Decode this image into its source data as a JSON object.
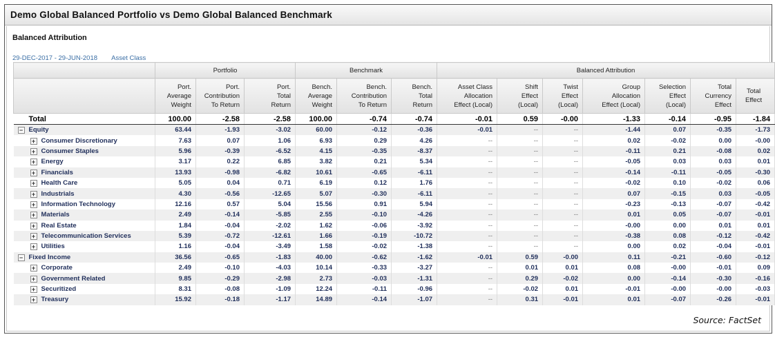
{
  "window_title": "Demo Global Balanced Portfolio vs Demo Global Balanced Benchmark",
  "report_title": "Balanced Attribution",
  "date_range": "29-DEC-2017 - 29-JUN-2018",
  "grouping": "Asset Class",
  "group_headers": [
    "Portfolio",
    "Benchmark",
    "Balanced Attribution"
  ],
  "columns": [
    [
      "Port.",
      "Average",
      "Weight"
    ],
    [
      "Port.",
      "Contribution",
      "To Return"
    ],
    [
      "Port.",
      "Total",
      "Return"
    ],
    [
      "Bench.",
      "Average",
      "Weight"
    ],
    [
      "Bench.",
      "Contribution",
      "To Return"
    ],
    [
      "Bench.",
      "Total",
      "Return"
    ],
    [
      "Asset Class",
      "Allocation",
      "Effect (Local)"
    ],
    [
      "Shift",
      "Effect",
      "(Local)"
    ],
    [
      "Twist",
      "Effect",
      "(Local)"
    ],
    [
      "Group",
      "Allocation",
      "Effect (Local)"
    ],
    [
      "Selection",
      "Effect",
      "(Local)"
    ],
    [
      "Total",
      "Currency",
      "Effect"
    ],
    [
      "Total",
      "Effect",
      ""
    ]
  ],
  "total_row": {
    "label": "Total",
    "values": [
      "100.00",
      "-2.58",
      "-2.58",
      "100.00",
      "-0.74",
      "-0.74",
      "-0.01",
      "0.59",
      "-0.00",
      "-1.33",
      "-0.14",
      "-0.95",
      "-1.84"
    ]
  },
  "rows": [
    {
      "label": "Equity",
      "level": 0,
      "expander": "minus",
      "values": [
        "63.44",
        "-1.93",
        "-3.02",
        "60.00",
        "-0.12",
        "-0.36",
        "-0.01",
        "--",
        "--",
        "-1.44",
        "0.07",
        "-0.35",
        "-1.73"
      ]
    },
    {
      "label": "Consumer Discretionary",
      "level": 1,
      "expander": "plus",
      "values": [
        "7.63",
        "0.07",
        "1.06",
        "6.93",
        "0.29",
        "4.26",
        "--",
        "--",
        "--",
        "0.02",
        "-0.02",
        "0.00",
        "-0.00"
      ]
    },
    {
      "label": "Consumer Staples",
      "level": 1,
      "expander": "plus",
      "values": [
        "5.96",
        "-0.39",
        "-6.52",
        "4.15",
        "-0.35",
        "-8.37",
        "--",
        "--",
        "--",
        "-0.11",
        "0.21",
        "-0.08",
        "0.02"
      ]
    },
    {
      "label": "Energy",
      "level": 1,
      "expander": "plus",
      "values": [
        "3.17",
        "0.22",
        "6.85",
        "3.82",
        "0.21",
        "5.34",
        "--",
        "--",
        "--",
        "-0.05",
        "0.03",
        "0.03",
        "0.01"
      ]
    },
    {
      "label": "Financials",
      "level": 1,
      "expander": "plus",
      "values": [
        "13.93",
        "-0.98",
        "-6.82",
        "10.61",
        "-0.65",
        "-6.11",
        "--",
        "--",
        "--",
        "-0.14",
        "-0.11",
        "-0.05",
        "-0.30"
      ]
    },
    {
      "label": "Health Care",
      "level": 1,
      "expander": "plus",
      "values": [
        "5.05",
        "0.04",
        "0.71",
        "6.19",
        "0.12",
        "1.76",
        "--",
        "--",
        "--",
        "-0.02",
        "0.10",
        "-0.02",
        "0.06"
      ]
    },
    {
      "label": "Industrials",
      "level": 1,
      "expander": "plus",
      "values": [
        "4.30",
        "-0.56",
        "-12.65",
        "5.07",
        "-0.30",
        "-6.11",
        "--",
        "--",
        "--",
        "0.07",
        "-0.15",
        "0.03",
        "-0.05"
      ]
    },
    {
      "label": "Information Technology",
      "level": 1,
      "expander": "plus",
      "values": [
        "12.16",
        "0.57",
        "5.04",
        "15.56",
        "0.91",
        "5.94",
        "--",
        "--",
        "--",
        "-0.23",
        "-0.13",
        "-0.07",
        "-0.42"
      ]
    },
    {
      "label": "Materials",
      "level": 1,
      "expander": "plus",
      "values": [
        "2.49",
        "-0.14",
        "-5.85",
        "2.55",
        "-0.10",
        "-4.26",
        "--",
        "--",
        "--",
        "0.01",
        "0.05",
        "-0.07",
        "-0.01"
      ]
    },
    {
      "label": "Real Estate",
      "level": 1,
      "expander": "plus",
      "values": [
        "1.84",
        "-0.04",
        "-2.02",
        "1.62",
        "-0.06",
        "-3.92",
        "--",
        "--",
        "--",
        "-0.00",
        "0.00",
        "0.01",
        "0.01"
      ]
    },
    {
      "label": "Telecommunication Services",
      "level": 1,
      "expander": "plus",
      "values": [
        "5.39",
        "-0.72",
        "-12.61",
        "1.66",
        "-0.19",
        "-10.72",
        "--",
        "--",
        "--",
        "-0.38",
        "0.08",
        "-0.12",
        "-0.42"
      ]
    },
    {
      "label": "Utilities",
      "level": 1,
      "expander": "plus",
      "values": [
        "1.16",
        "-0.04",
        "-3.49",
        "1.58",
        "-0.02",
        "-1.38",
        "--",
        "--",
        "--",
        "0.00",
        "0.02",
        "-0.04",
        "-0.01"
      ]
    },
    {
      "label": "Fixed Income",
      "level": 0,
      "expander": "minus",
      "values": [
        "36.56",
        "-0.65",
        "-1.83",
        "40.00",
        "-0.62",
        "-1.62",
        "-0.01",
        "0.59",
        "-0.00",
        "0.11",
        "-0.21",
        "-0.60",
        "-0.12"
      ]
    },
    {
      "label": "Corporate",
      "level": 1,
      "expander": "plus",
      "values": [
        "2.49",
        "-0.10",
        "-4.03",
        "10.14",
        "-0.33",
        "-3.27",
        "--",
        "0.01",
        "0.01",
        "0.08",
        "-0.00",
        "-0.01",
        "0.09"
      ]
    },
    {
      "label": "Government Related",
      "level": 1,
      "expander": "plus",
      "values": [
        "9.85",
        "-0.29",
        "-2.98",
        "2.73",
        "-0.03",
        "-1.31",
        "--",
        "0.29",
        "-0.02",
        "0.00",
        "-0.14",
        "-0.30",
        "-0.16"
      ]
    },
    {
      "label": "Securitized",
      "level": 1,
      "expander": "plus",
      "values": [
        "8.31",
        "-0.08",
        "-1.09",
        "12.24",
        "-0.11",
        "-0.96",
        "--",
        "-0.02",
        "0.01",
        "-0.01",
        "-0.00",
        "-0.00",
        "-0.03"
      ]
    },
    {
      "label": "Treasury",
      "level": 1,
      "expander": "plus",
      "values": [
        "15.92",
        "-0.18",
        "-1.17",
        "14.89",
        "-0.14",
        "-1.07",
        "--",
        "0.31",
        "-0.01",
        "0.01",
        "-0.07",
        "-0.26",
        "-0.01"
      ]
    }
  ],
  "source": "Source: FactSet"
}
